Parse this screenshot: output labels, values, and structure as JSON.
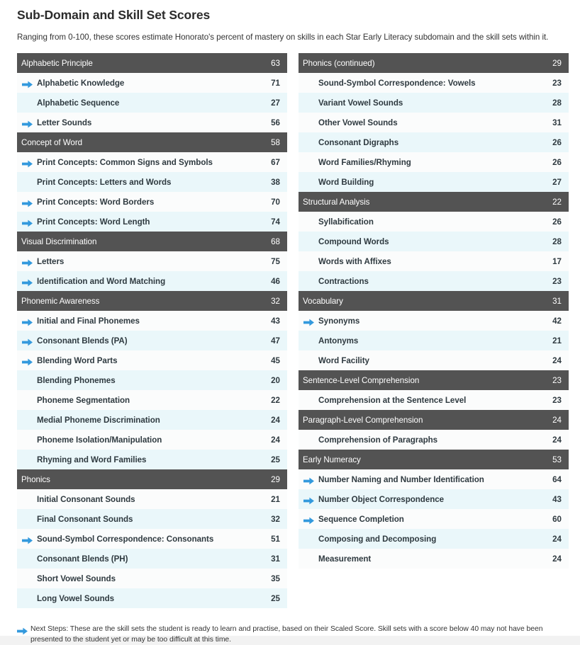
{
  "title": "Sub-Domain and Skill Set Scores",
  "description": "Ranging from 0-100, these scores estimate Honorato's percent of mastery on skills in each Star Early Literacy subdomain and the skill sets within it.",
  "colors": {
    "header_background": "#535353",
    "header_text": "#ffffff",
    "row_light": "#fbfcfc",
    "row_alt": "#eaf7fa",
    "arrow": "#3399dd",
    "text": "#2f3a40",
    "page_background": "#f2f2f2"
  },
  "footnote": {
    "icon": "next-steps-arrow-icon",
    "text": "Next Steps: These are the skill sets the student is ready to learn and practise, based on their Scaled Score. Skill sets with a score below 40 may not have been presented to the student yet or may be too difficult at this time."
  },
  "left_column": [
    {
      "type": "header",
      "label": "Alphabetic Principle",
      "score": "63",
      "arrow": false
    },
    {
      "type": "child",
      "label": "Alphabetic Knowledge",
      "score": "71",
      "arrow": true
    },
    {
      "type": "child",
      "label": "Alphabetic Sequence",
      "score": "27",
      "arrow": false
    },
    {
      "type": "child",
      "label": "Letter Sounds",
      "score": "56",
      "arrow": true
    },
    {
      "type": "header",
      "label": "Concept of Word",
      "score": "58",
      "arrow": false
    },
    {
      "type": "child",
      "label": "Print Concepts: Common Signs and Symbols",
      "score": "67",
      "arrow": true
    },
    {
      "type": "child",
      "label": "Print Concepts: Letters and Words",
      "score": "38",
      "arrow": false
    },
    {
      "type": "child",
      "label": "Print Concepts: Word Borders",
      "score": "70",
      "arrow": true
    },
    {
      "type": "child",
      "label": "Print Concepts: Word Length",
      "score": "74",
      "arrow": true
    },
    {
      "type": "header",
      "label": "Visual Discrimination",
      "score": "68",
      "arrow": false
    },
    {
      "type": "child",
      "label": "Letters",
      "score": "75",
      "arrow": true
    },
    {
      "type": "child",
      "label": "Identification and Word Matching",
      "score": "46",
      "arrow": true
    },
    {
      "type": "header",
      "label": "Phonemic Awareness",
      "score": "32",
      "arrow": false
    },
    {
      "type": "child",
      "label": "Initial and Final Phonemes",
      "score": "43",
      "arrow": true
    },
    {
      "type": "child",
      "label": "Consonant Blends (PA)",
      "score": "47",
      "arrow": true
    },
    {
      "type": "child",
      "label": "Blending Word Parts",
      "score": "45",
      "arrow": true
    },
    {
      "type": "child",
      "label": "Blending Phonemes",
      "score": "20",
      "arrow": false
    },
    {
      "type": "child",
      "label": "Phoneme Segmentation",
      "score": "22",
      "arrow": false
    },
    {
      "type": "child",
      "label": "Medial Phoneme Discrimination",
      "score": "24",
      "arrow": false
    },
    {
      "type": "child",
      "label": "Phoneme Isolation/Manipulation",
      "score": "24",
      "arrow": false
    },
    {
      "type": "child",
      "label": "Rhyming and Word Families",
      "score": "25",
      "arrow": false
    },
    {
      "type": "header",
      "label": "Phonics",
      "score": "29",
      "arrow": false
    },
    {
      "type": "child",
      "label": "Initial Consonant Sounds",
      "score": "21",
      "arrow": false
    },
    {
      "type": "child",
      "label": "Final Consonant Sounds",
      "score": "32",
      "arrow": false
    },
    {
      "type": "child",
      "label": "Sound-Symbol Correspondence: Consonants",
      "score": "51",
      "arrow": true
    },
    {
      "type": "child",
      "label": "Consonant Blends (PH)",
      "score": "31",
      "arrow": false
    },
    {
      "type": "child",
      "label": "Short Vowel Sounds",
      "score": "35",
      "arrow": false
    },
    {
      "type": "child",
      "label": "Long Vowel Sounds",
      "score": "25",
      "arrow": false
    }
  ],
  "right_column": [
    {
      "type": "header",
      "label": "Phonics (continued)",
      "score": "29",
      "arrow": false
    },
    {
      "type": "child",
      "label": "Sound-Symbol Correspondence: Vowels",
      "score": "23",
      "arrow": false
    },
    {
      "type": "child",
      "label": "Variant Vowel Sounds",
      "score": "28",
      "arrow": false
    },
    {
      "type": "child",
      "label": "Other Vowel Sounds",
      "score": "31",
      "arrow": false
    },
    {
      "type": "child",
      "label": "Consonant Digraphs",
      "score": "26",
      "arrow": false
    },
    {
      "type": "child",
      "label": "Word Families/Rhyming",
      "score": "26",
      "arrow": false
    },
    {
      "type": "child",
      "label": "Word Building",
      "score": "27",
      "arrow": false
    },
    {
      "type": "header",
      "label": "Structural Analysis",
      "score": "22",
      "arrow": false
    },
    {
      "type": "child",
      "label": "Syllabification",
      "score": "26",
      "arrow": false
    },
    {
      "type": "child",
      "label": "Compound Words",
      "score": "28",
      "arrow": false
    },
    {
      "type": "child",
      "label": "Words with Affixes",
      "score": "17",
      "arrow": false
    },
    {
      "type": "child",
      "label": "Contractions",
      "score": "23",
      "arrow": false
    },
    {
      "type": "header",
      "label": "Vocabulary",
      "score": "31",
      "arrow": false
    },
    {
      "type": "child",
      "label": "Synonyms",
      "score": "42",
      "arrow": true
    },
    {
      "type": "child",
      "label": "Antonyms",
      "score": "21",
      "arrow": false
    },
    {
      "type": "child",
      "label": "Word Facility",
      "score": "24",
      "arrow": false
    },
    {
      "type": "header",
      "label": "Sentence-Level Comprehension",
      "score": "23",
      "arrow": false
    },
    {
      "type": "child",
      "label": "Comprehension at the Sentence Level",
      "score": "23",
      "arrow": false
    },
    {
      "type": "header",
      "label": "Paragraph-Level Comprehension",
      "score": "24",
      "arrow": false
    },
    {
      "type": "child",
      "label": "Comprehension of Paragraphs",
      "score": "24",
      "arrow": false
    },
    {
      "type": "header",
      "label": "Early Numeracy",
      "score": "53",
      "arrow": false
    },
    {
      "type": "child",
      "label": "Number Naming and Number Identification",
      "score": "64",
      "arrow": true
    },
    {
      "type": "child",
      "label": "Number Object Correspondence",
      "score": "43",
      "arrow": true
    },
    {
      "type": "child",
      "label": "Sequence Completion",
      "score": "60",
      "arrow": true
    },
    {
      "type": "child",
      "label": "Composing and Decomposing",
      "score": "24",
      "arrow": false
    },
    {
      "type": "child",
      "label": "Measurement",
      "score": "24",
      "arrow": false
    }
  ]
}
